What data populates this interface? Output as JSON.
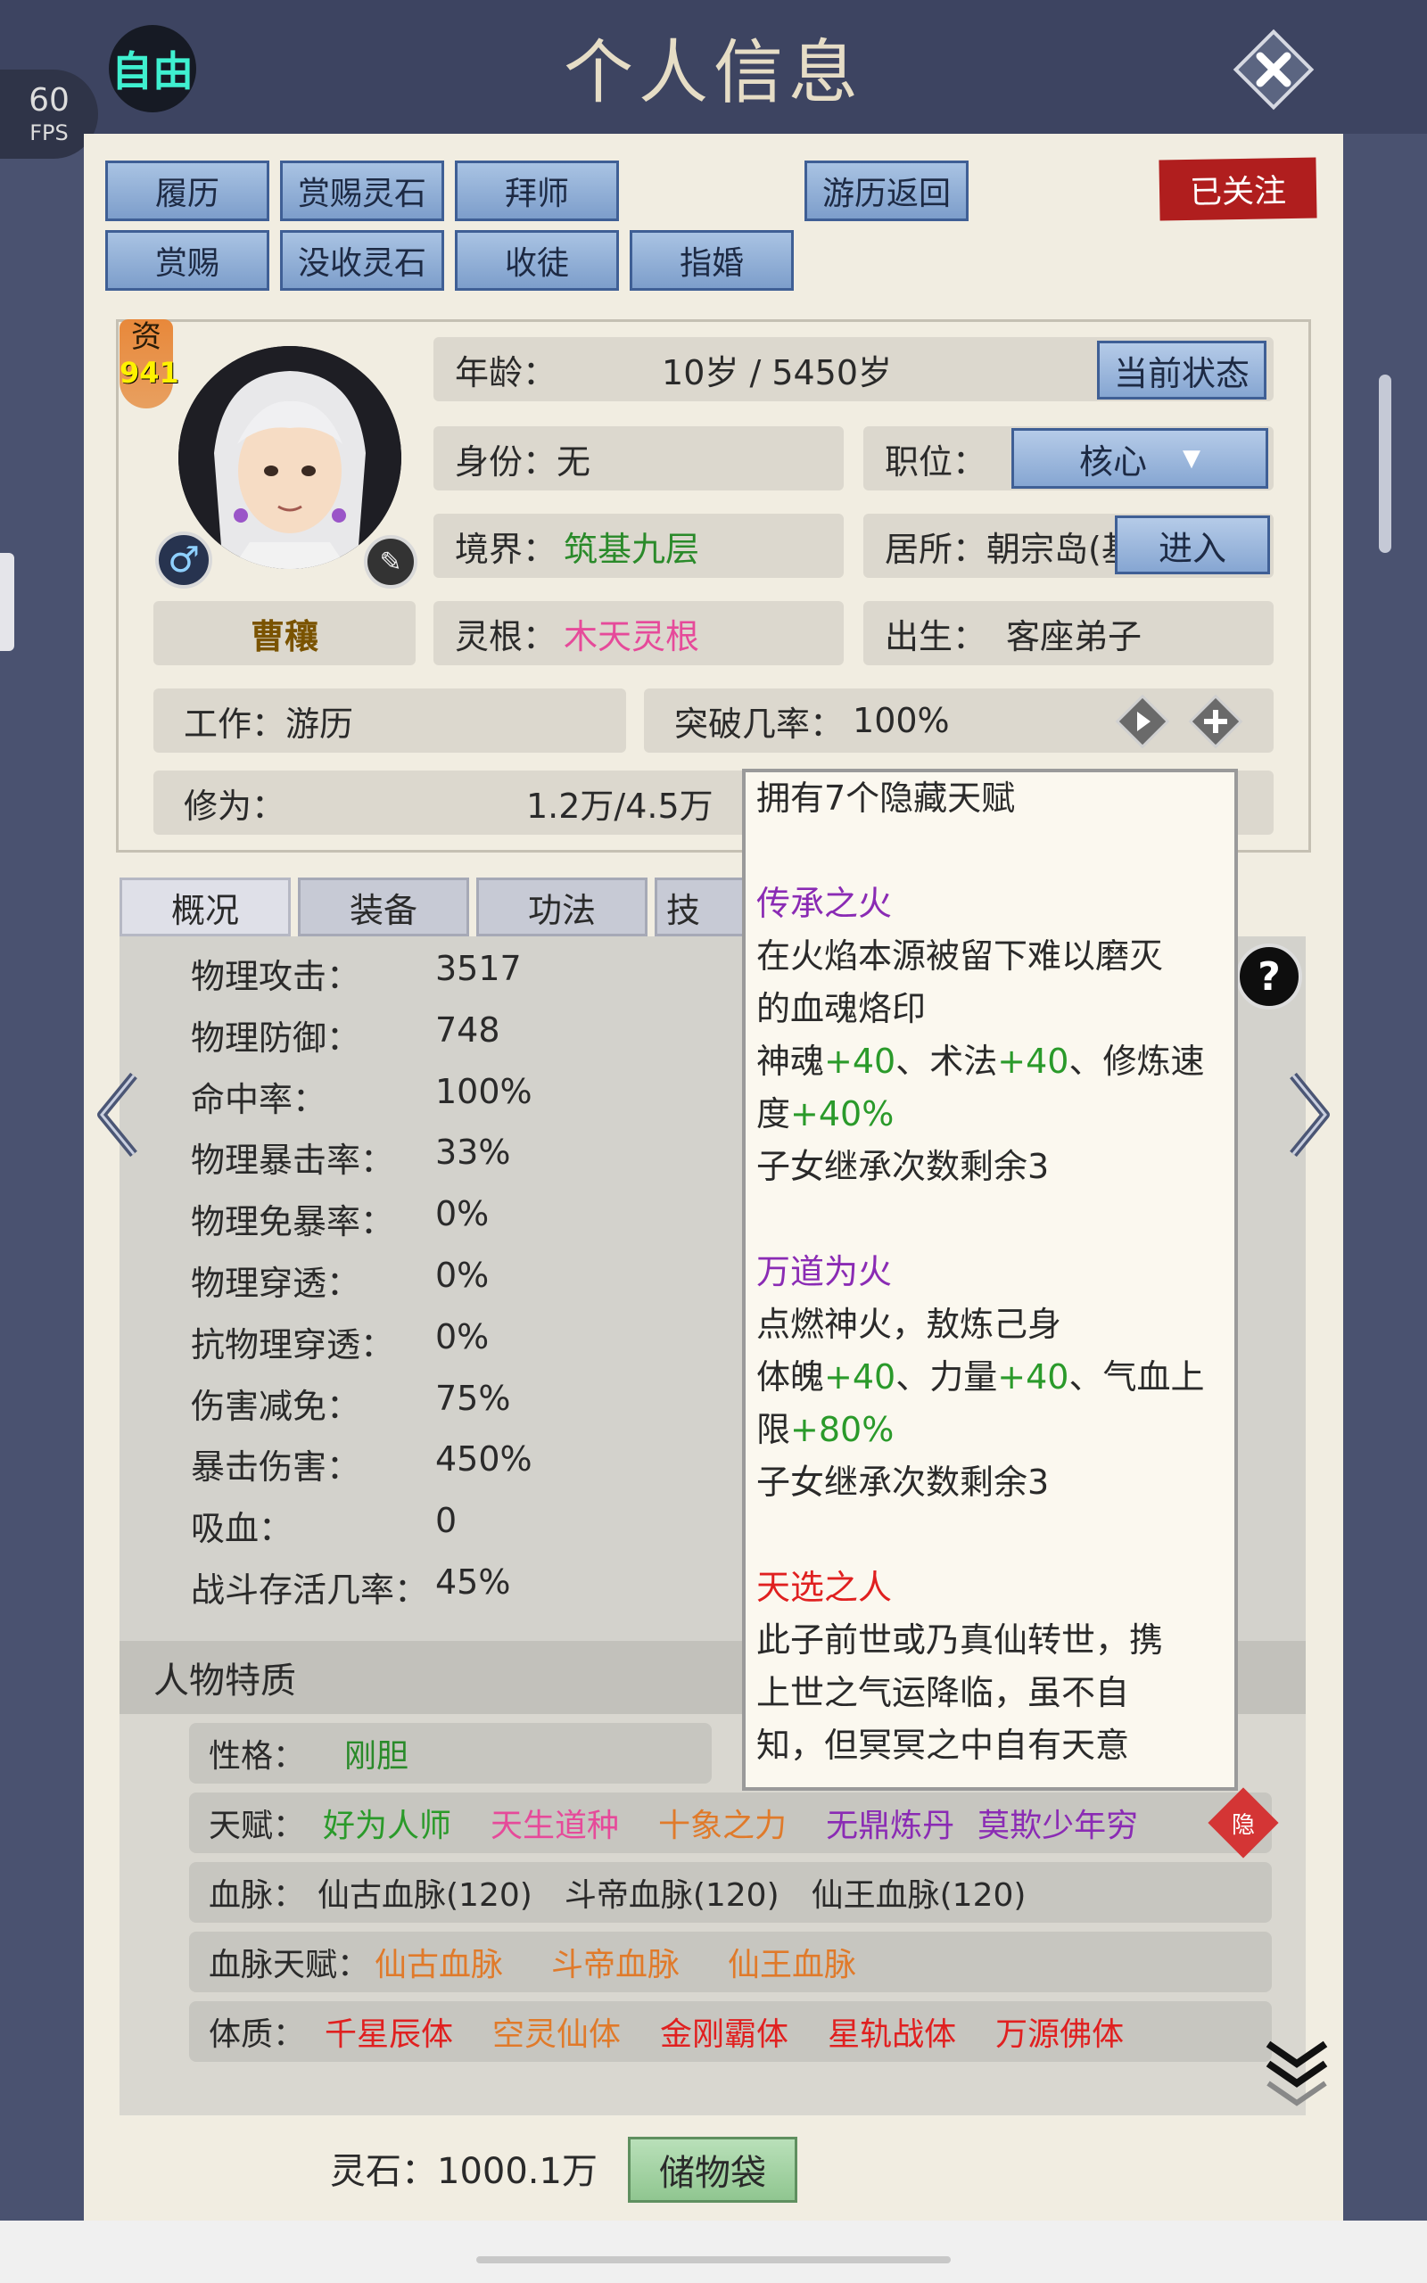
{
  "header": {
    "mode_badge": "自由",
    "title": "个人信息",
    "fps_value": "60",
    "fps_unit": "FPS"
  },
  "actions_row1": [
    "履历",
    "赏赐灵石",
    "拜师",
    "游历返回"
  ],
  "actions_row2": [
    "赏赐",
    "没收灵石",
    "收徒",
    "指婚"
  ],
  "follow_label": "已关注",
  "profile": {
    "aptitude_label": "资",
    "aptitude_value": "941",
    "name": "曹穰",
    "age_label": "年龄：",
    "age_value": "10岁 / 5450岁",
    "current_state_button": "当前状态",
    "identity_label": "身份：",
    "identity_value": "无",
    "position_label": "职位：",
    "position_value": "核心",
    "realm_label": "境界：",
    "realm_value": "筑基九层",
    "residence_label": "居所：",
    "residence_value": "朝宗岛(基",
    "enter_button": "进入",
    "root_label": "灵根：",
    "root_value": "木天灵根",
    "birth_label": "出生：",
    "birth_value": "客座弟子",
    "work_label": "工作：",
    "work_value": "游历",
    "breakthrough_label": "突破几率：",
    "breakthrough_value": "100%",
    "cultivation_label": "修为：",
    "cultivation_value": "1.2万/4.5万"
  },
  "tabs": [
    "概况",
    "装备",
    "功法",
    "技"
  ],
  "stats": [
    {
      "label": "物理攻击：",
      "value": "3517"
    },
    {
      "label": "物理防御：",
      "value": "748"
    },
    {
      "label": "命中率：",
      "value": "100%"
    },
    {
      "label": "物理暴击率：",
      "value": "33%"
    },
    {
      "label": "物理免暴率：",
      "value": "0%"
    },
    {
      "label": "物理穿透：",
      "value": "0%"
    },
    {
      "label": "抗物理穿透：",
      "value": "0%"
    },
    {
      "label": "伤害减免：",
      "value": "75%"
    },
    {
      "label": "暴击伤害：",
      "value": "450%"
    },
    {
      "label": "吸血：",
      "value": "0"
    },
    {
      "label": "战斗存活几率：",
      "value": "45%"
    }
  ],
  "traits": {
    "header": "人物特质",
    "personality_label": "性格：",
    "personality_value": "刚胆",
    "talent_label": "天赋：",
    "talents": [
      "好为人师",
      "天生道种",
      "十象之力",
      "无鼎炼丹",
      "莫欺少年穷"
    ],
    "hidden_badge": "隐",
    "bloodline_label": "血脉：",
    "bloodlines": [
      "仙古血脉(120)",
      "斗帝血脉(120)",
      "仙王血脉(120)"
    ],
    "bloodline_talent_label": "血脉天赋：",
    "bloodline_talents": [
      "仙古血脉",
      "斗帝血脉",
      "仙王血脉"
    ],
    "constitution_label": "体质：",
    "constitutions": [
      "千星辰体",
      "空灵仙体",
      "金刚霸体",
      "星轨战体",
      "万源佛体"
    ]
  },
  "tooltip": {
    "intro": "拥有7个隐藏天赋",
    "t1_name": "传承之火",
    "t1_desc_a": "在火焰本源被留下难以磨灭",
    "t1_desc_b": "的血魂烙印",
    "t1_b1": "神魂",
    "t1_b1v": "+40",
    "t1_sep1": "、",
    "t1_b2": "术法",
    "t1_b2v": "+40",
    "t1_sep2": "、",
    "t1_b3": "修炼速",
    "t1_b3b": "度",
    "t1_b3v": "+40%",
    "t1_rem": "子女继承次数剩余3",
    "t2_name": "万道为火",
    "t2_desc": "点燃神火，敖炼己身",
    "t2_b1": "体魄",
    "t2_b1v": "+40",
    "t2_sep1": "、",
    "t2_b2": "力量",
    "t2_b2v": "+40",
    "t2_sep2": "、",
    "t2_b3": "气血上",
    "t2_b3b": "限",
    "t2_b3v": "+80%",
    "t2_rem": "子女继承次数剩余3",
    "t3_name": "天选之人",
    "t3_desc_a": "此子前世或乃真仙转世，携",
    "t3_desc_b": "上世之气运降临，虽不自",
    "t3_desc_c": "知，但冥冥之中自有天意"
  },
  "footer": {
    "spirit_stones": "灵石：1000.1万",
    "bag_button": "储物袋"
  },
  "colors": {
    "accent_blue": "#86a6d2",
    "follow_red": "#b01e1e",
    "green_bonus": "#2a9a2a",
    "purple_name": "#8a2bb4",
    "red_name": "#e02020"
  }
}
